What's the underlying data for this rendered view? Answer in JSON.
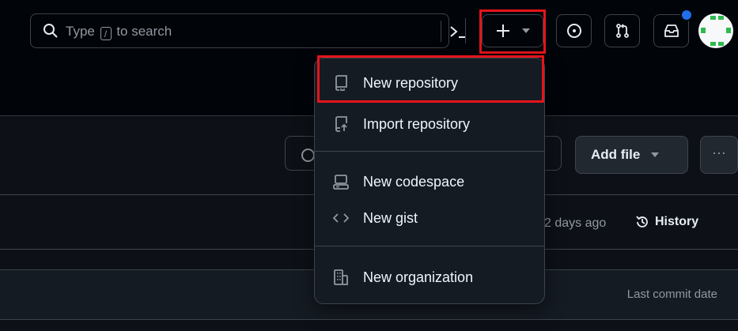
{
  "header": {
    "search": {
      "placeholder_before": "Type",
      "kbd": "/",
      "placeholder_after": "to search",
      "icon": "search-icon",
      "command_icon": "command-palette-icon"
    },
    "create_button": {
      "icon": "plus-icon",
      "caret": "triangle-down-icon"
    },
    "issues_icon": "issue-opened-icon",
    "pull_requests_icon": "git-pull-request-icon",
    "inbox_icon": "inbox-icon",
    "notification_dot_color": "#1f6feb",
    "avatar": "identicon-avatar"
  },
  "create_menu": {
    "items": [
      {
        "label": "New repository",
        "icon": "repo-icon"
      },
      {
        "label": "Import repository",
        "icon": "repo-push-icon"
      },
      {
        "label": "New codespace",
        "icon": "codespaces-icon"
      },
      {
        "label": "New gist",
        "icon": "code-icon"
      },
      {
        "label": "New organization",
        "icon": "organization-icon"
      }
    ]
  },
  "repo": {
    "add_file_label": "Add file",
    "more_label": "···",
    "commit_time": "2 days ago",
    "history_label": "History",
    "last_commit_date_label": "Last commit date"
  },
  "colors": {
    "accent_highlight": "#e5141c",
    "background": "#0d1117",
    "header_bg": "#010409"
  }
}
